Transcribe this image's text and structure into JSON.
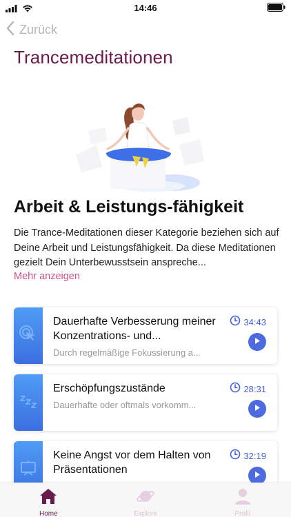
{
  "status_bar": {
    "time": "14:46"
  },
  "nav": {
    "back_label": "Zurück"
  },
  "page": {
    "title": "Trancemeditationen"
  },
  "category": {
    "title": "Arbeit & Leistungs-fähigkeit",
    "description": "Die Trance-Meditationen dieser Kategorie beziehen sich auf Deine Arbeit und Leistungsfähigkeit. Da diese Meditationen gezielt Dein Unterbewusstsein anspreche...",
    "more_label": "Mehr anzeigen"
  },
  "meditations": [
    {
      "title": "Dauerhafte Verbesserung meiner Konzentrations- und...",
      "subtitle": "Durch regelmäßige Fokussierung a...",
      "duration": "34:43",
      "icon": "cursor-click-icon"
    },
    {
      "title": "Erschöpfungszustände",
      "subtitle": "Dauerhafte oder oftmals vorkomm...",
      "duration": "28:31",
      "icon": "sleep-zzz-icon"
    },
    {
      "title": "Keine Angst vor dem Halten von Präsentationen",
      "subtitle": "",
      "duration": "32:19",
      "icon": "presentation-board-icon"
    }
  ],
  "tabs": [
    {
      "label": "Home",
      "icon": "home-icon",
      "active": true
    },
    {
      "label": "Explore",
      "icon": "planet-icon",
      "active": false
    },
    {
      "label": "Profil",
      "icon": "profile-icon",
      "active": false
    }
  ],
  "colors": {
    "title": "#6b1a4e",
    "link": "#d44f86",
    "accent_blue": "#4d6ae0",
    "thumb_gradient_top": "#4f9cf5",
    "thumb_gradient_bottom": "#3c6fe0"
  }
}
